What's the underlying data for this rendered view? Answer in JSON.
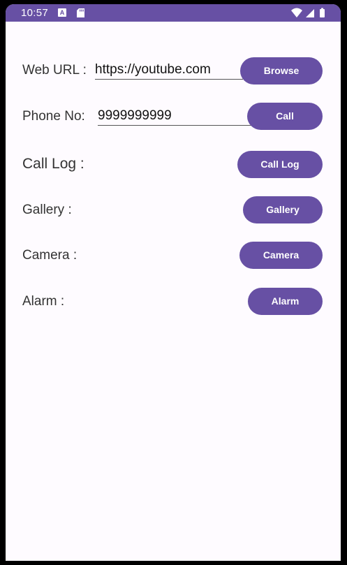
{
  "status_bar": {
    "time": "10:57",
    "notification_icon": "A",
    "colors": {
      "bar": "#6750a4"
    }
  },
  "form": {
    "web_url": {
      "label": "Web URL :",
      "value": "https://youtube.com",
      "button": "Browse"
    },
    "phone": {
      "label": "Phone No:",
      "value": "9999999999",
      "button": "Call"
    },
    "call_log": {
      "label": "Call Log :",
      "button": "Call Log"
    },
    "gallery": {
      "label": "Gallery :",
      "button": "Gallery"
    },
    "camera": {
      "label": "Camera :",
      "button": "Camera"
    },
    "alarm": {
      "label": "Alarm :",
      "button": "Alarm"
    }
  },
  "theme": {
    "accent": "#6750a4",
    "background": "#fefbff"
  }
}
